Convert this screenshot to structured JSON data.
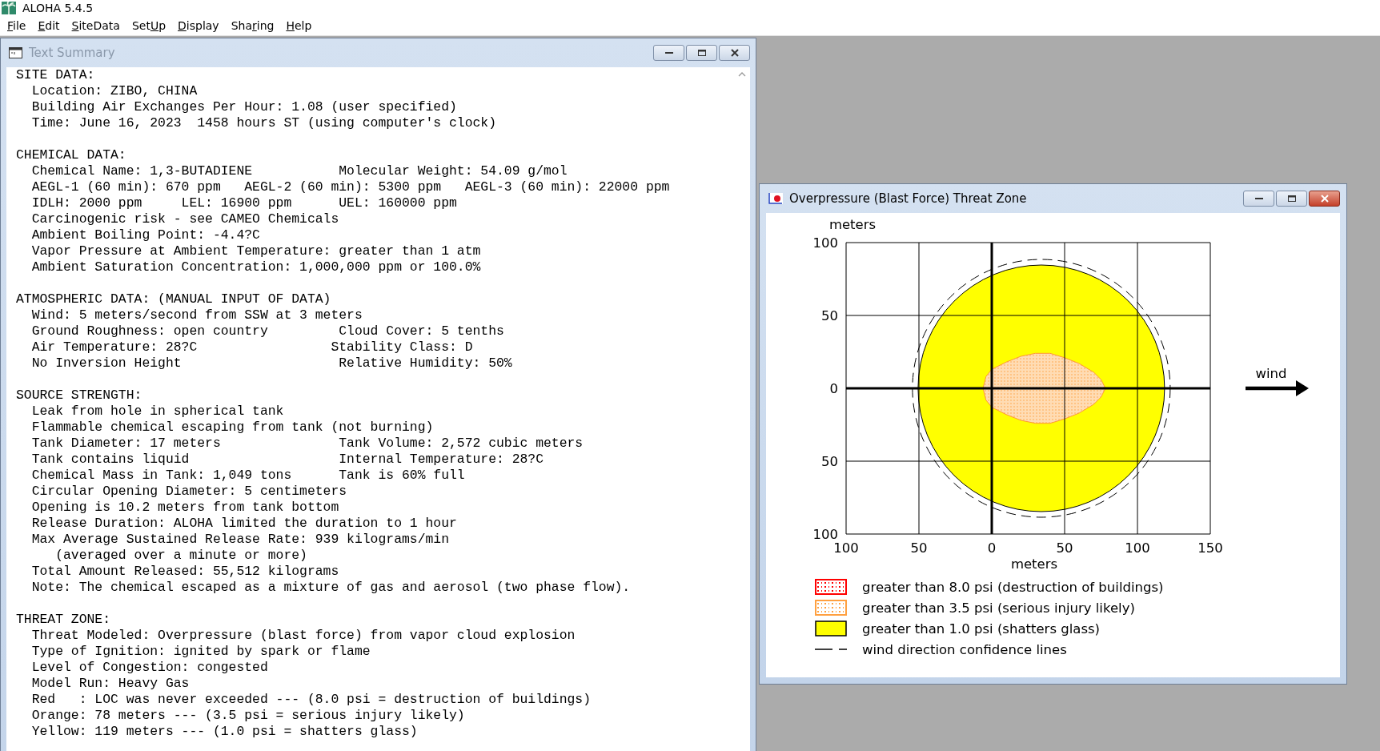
{
  "app": {
    "title": "ALOHA 5.4.5"
  },
  "menu": [
    {
      "key": "F",
      "post": "ile"
    },
    {
      "key": "E",
      "post": "dit"
    },
    {
      "key": "S",
      "post": "iteData"
    },
    {
      "pre": "Set",
      "key": "U",
      "post": "p"
    },
    {
      "key": "D",
      "post": "isplay"
    },
    {
      "pre": "Sha",
      "key": "r",
      "post": "ing"
    },
    {
      "key": "H",
      "post": "elp"
    }
  ],
  "text_window": {
    "title": "Text Summary",
    "active": false,
    "sections": [
      {
        "heading": "SITE DATA:",
        "lines": [
          {
            "text": "Location: ZIBO, CHINA",
            "kind": "line"
          },
          {
            "text": "Building Air Exchanges Per Hour: 1.08 (user specified)",
            "kind": "line"
          },
          {
            "text": "Time: June 16, 2023  1458 hours ST (using computer's clock)",
            "kind": "line"
          }
        ]
      },
      {
        "heading": "CHEMICAL DATA:",
        "lines": [
          {
            "text": "Chemical Name: 1,3-BUTADIENE           Molecular Weight: 54.09 g/mol",
            "kind": "line"
          },
          {
            "text": "AEGL-1 (60 min): 670 ppm   AEGL-2 (60 min): 5300 ppm   AEGL-3 (60 min): 22000 ppm",
            "kind": "line"
          },
          {
            "text": "IDLH: 2000 ppm     LEL: 16900 ppm      UEL: 160000 ppm",
            "kind": "line"
          },
          {
            "text": "Carcinogenic risk - see CAMEO Chemicals",
            "kind": "line"
          },
          {
            "text": "Ambient Boiling Point: -4.4?C",
            "kind": "line"
          },
          {
            "text": "Vapor Pressure at Ambient Temperature: greater than 1 atm",
            "kind": "line"
          },
          {
            "text": "Ambient Saturation Concentration: 1,000,000 ppm or 100.0%",
            "kind": "line"
          }
        ]
      },
      {
        "heading": "ATMOSPHERIC DATA: (MANUAL INPUT OF DATA)",
        "lines": [
          {
            "text": "Wind: 5 meters/second from SSW at 3 meters",
            "kind": "line"
          },
          {
            "text": "Ground Roughness: open country         Cloud Cover: 5 tenths",
            "kind": "line"
          },
          {
            "text": "Air Temperature: 28?C                 Stability Class: D",
            "kind": "line"
          },
          {
            "text": "No Inversion Height                    Relative Humidity: 50%",
            "kind": "line"
          }
        ]
      },
      {
        "heading": "SOURCE STRENGTH:",
        "lines": [
          {
            "text": "Leak from hole in spherical tank",
            "kind": "line"
          },
          {
            "text": "Flammable chemical escaping from tank (not burning)",
            "kind": "line"
          },
          {
            "text": "Tank Diameter: 17 meters               Tank Volume: 2,572 cubic meters",
            "kind": "line"
          },
          {
            "text": "Tank contains liquid                   Internal Temperature: 28?C",
            "kind": "line"
          },
          {
            "text": "Chemical Mass in Tank: 1,049 tons      Tank is 60% full",
            "kind": "line"
          },
          {
            "text": "Circular Opening Diameter: 5 centimeters",
            "kind": "line"
          },
          {
            "text": "Opening is 10.2 meters from tank bottom",
            "kind": "line"
          },
          {
            "text": "Release Duration: ALOHA limited the duration to 1 hour",
            "kind": "line"
          },
          {
            "text": "Max Average Sustained Release Rate: 939 kilograms/min",
            "kind": "line"
          },
          {
            "text": "(averaged over a minute or more)",
            "kind": "continuation"
          },
          {
            "text": "Total Amount Released: 55,512 kilograms",
            "kind": "line"
          },
          {
            "text": "Note: The chemical escaped as a mixture of gas and aerosol (two phase flow).",
            "kind": "line"
          }
        ]
      },
      {
        "heading": "THREAT ZONE:",
        "lines": [
          {
            "text": "Threat Modeled: Overpressure (blast force) from vapor cloud explosion",
            "kind": "line"
          },
          {
            "text": "Type of Ignition: ignited by spark or flame",
            "kind": "line"
          },
          {
            "text": "Level of Congestion: congested",
            "kind": "line"
          },
          {
            "text": "Model Run: Heavy Gas",
            "kind": "line"
          },
          {
            "text": "Red   : LOC was never exceeded --- (8.0 psi = destruction of buildings)",
            "kind": "line"
          },
          {
            "text": "Orange: 78 meters --- (3.5 psi = serious injury likely)",
            "kind": "line"
          },
          {
            "text": "Yellow: 119 meters --- (1.0 psi = shatters glass)",
            "kind": "line"
          }
        ]
      }
    ]
  },
  "threat_window": {
    "title": "Overpressure (Blast Force) Threat Zone",
    "active": true,
    "plot": {
      "y_title": "meters",
      "y_ticks": [
        "100",
        "50",
        "0",
        "50",
        "100"
      ],
      "x_ticks": [
        "100",
        "50",
        "0",
        "50",
        "100",
        "150"
      ],
      "x_title": "meters"
    },
    "wind_label": "wind",
    "legend": [
      {
        "label": "greater than 8.0 psi (destruction of buildings)",
        "kind": "dotted",
        "color": "#ff0000"
      },
      {
        "label": "greater than 3.5 psi (serious injury likely)",
        "kind": "dotted",
        "color": "#ffa040"
      },
      {
        "label": "greater than 1.0 psi (shatters glass)",
        "kind": "solid",
        "color": "#ffff00"
      },
      {
        "label": "wind direction confidence lines",
        "kind": "dashed"
      }
    ]
  }
}
